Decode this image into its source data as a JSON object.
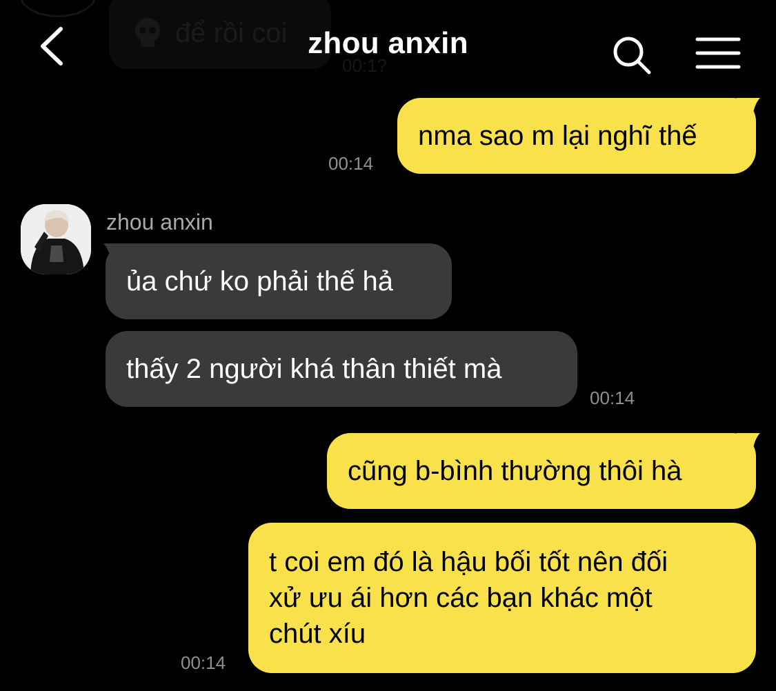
{
  "header": {
    "title": "zhou anxin",
    "back_icon": "chevron-left-icon",
    "search_icon": "search-icon",
    "menu_icon": "hamburger-menu-icon"
  },
  "previous_message": {
    "text": "để rồi coi",
    "time": "00:1?"
  },
  "contact": {
    "name": "zhou anxin",
    "avatar_icon": "avatar"
  },
  "colors": {
    "my_bubble": "#f9e14b",
    "their_bubble": "#3a3a3c",
    "background": "#000000",
    "timestamp": "#8e8e93"
  },
  "messages": [
    {
      "sender": "me",
      "text": "nma sao m lại nghĩ thế",
      "time": "00:14"
    },
    {
      "sender": "them",
      "text": "ủa chứ ko phải thế hả"
    },
    {
      "sender": "them",
      "text": "thấy 2 người khá thân thiết mà",
      "time": "00:14"
    },
    {
      "sender": "me",
      "text": "cũng b-bình thường thôi hà"
    },
    {
      "sender": "me",
      "text": "t coi em đó là hậu bối tốt nên đối\nxử ưu ái hơn các bạn khác một\nchút xíu",
      "time": "00:14"
    }
  ]
}
